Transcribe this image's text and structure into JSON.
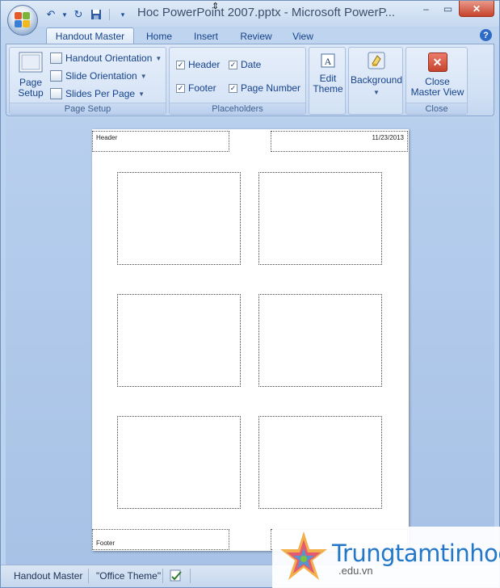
{
  "window": {
    "title": "Hoc PowerPoint 2007.pptx - Microsoft PowerP..."
  },
  "qat": {
    "undo_icon": "undo-icon",
    "redo_icon": "redo-icon",
    "save_icon": "save-icon"
  },
  "tabs": [
    {
      "label": "Handout Master",
      "active": true
    },
    {
      "label": "Home",
      "active": false
    },
    {
      "label": "Insert",
      "active": false
    },
    {
      "label": "Review",
      "active": false
    },
    {
      "label": "View",
      "active": false
    }
  ],
  "ribbon": {
    "page_setup": {
      "page_setup_label": "Page Setup",
      "handout_orientation": "Handout Orientation",
      "slide_orientation": "Slide Orientation",
      "slides_per_page": "Slides Per Page",
      "group_label": "Page Setup"
    },
    "placeholders": {
      "header": "Header",
      "date": "Date",
      "footer": "Footer",
      "page_number": "Page Number",
      "header_checked": true,
      "date_checked": true,
      "footer_checked": true,
      "page_number_checked": true,
      "group_label": "Placeholders"
    },
    "edit_theme": {
      "label_line1": "Edit",
      "label_line2": "Theme"
    },
    "background": {
      "label": "Background"
    },
    "close": {
      "label_line1": "Close",
      "label_line2": "Master View",
      "group_label": "Close"
    }
  },
  "handout": {
    "header_text": "Header",
    "date_text": "11/23/2013",
    "footer_text": "Footer"
  },
  "statusbar": {
    "mode": "Handout Master",
    "theme": "\"Office Theme\""
  },
  "watermark": {
    "brand": "Trungtamtinhoc",
    "domain": ".edu.vn"
  },
  "colors": {
    "accent": "#15428b",
    "ribbon_bg": "#d1e0f4",
    "close_red": "#c7432d",
    "brand_blue": "#2277c9"
  }
}
